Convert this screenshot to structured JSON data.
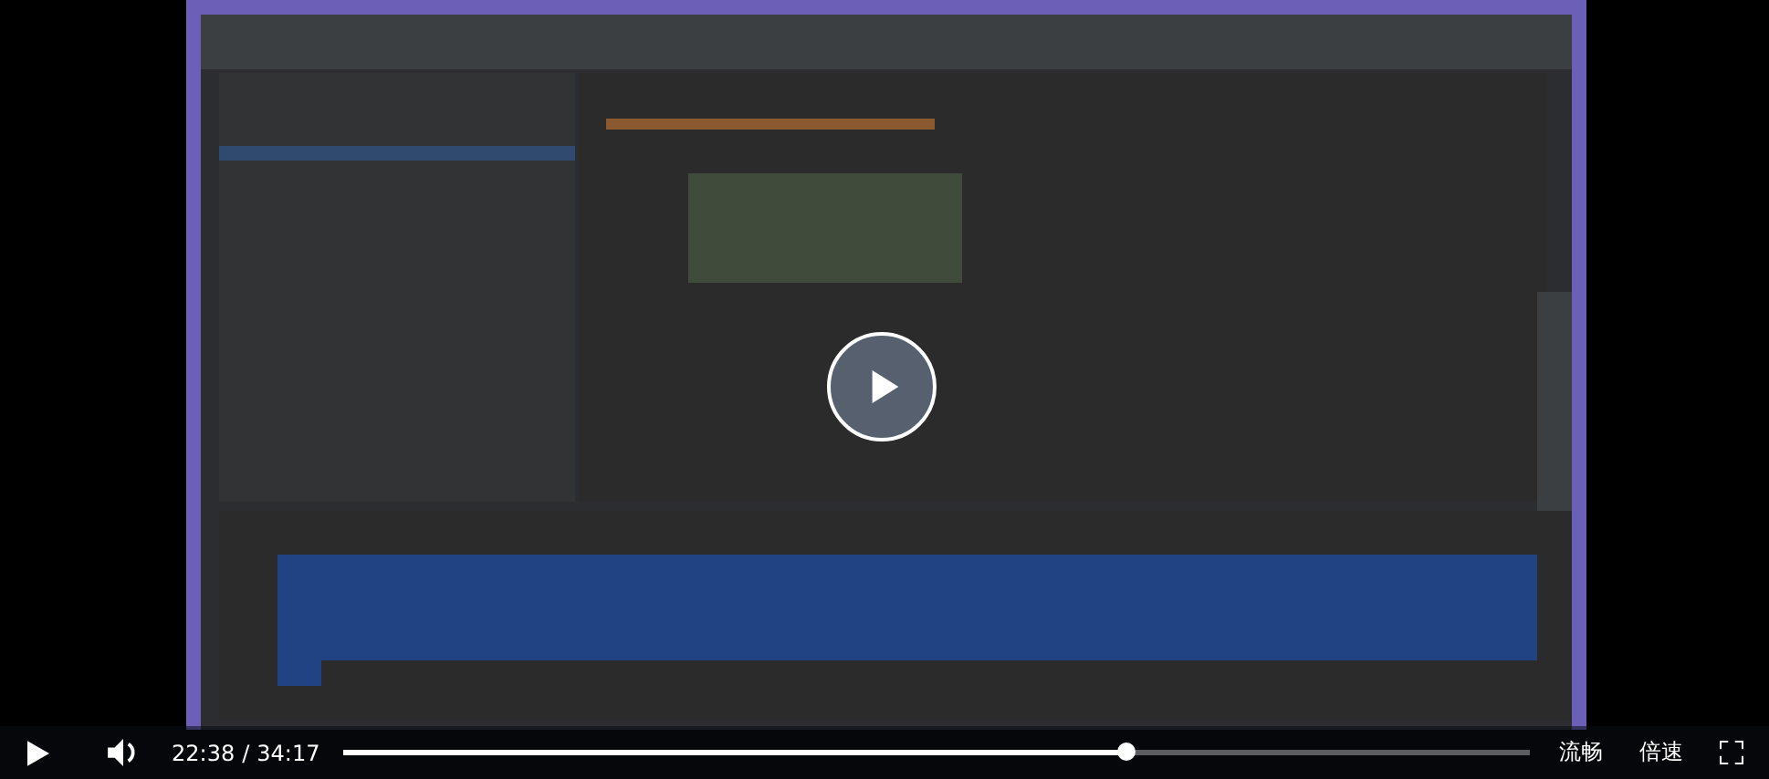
{
  "controls": {
    "current_time": "22:38",
    "separator": "/",
    "total_time": "34:17",
    "progress": {
      "level": 0.66
    },
    "quality": "流畅",
    "speed": "倍速"
  }
}
